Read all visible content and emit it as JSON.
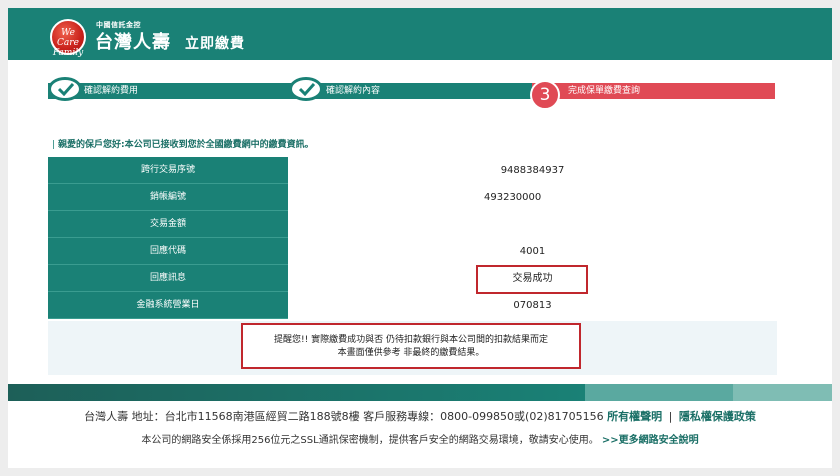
{
  "header": {
    "logo_text": "We Care Family",
    "brand_sub": "中國信託金控",
    "brand_name": "台灣人壽",
    "page_title": "立即繳費"
  },
  "steps": [
    {
      "label": "確認解約費用",
      "state": "done"
    },
    {
      "label": "確認解約內容",
      "state": "done"
    },
    {
      "number": "3",
      "label": "完成保單繳費查詢",
      "state": "current"
    }
  ],
  "notice": {
    "bar": "|",
    "text": "親愛的保戶您好:本公司已接收到您於全國繳費網中的繳費資訊。"
  },
  "table": {
    "rows": [
      {
        "label": "跨行交易序號",
        "value": "9488384937"
      },
      {
        "label": "銷帳編號",
        "value": "493230000"
      },
      {
        "label": "交易金額",
        "value": ""
      },
      {
        "label": "回應代碼",
        "value": "4001"
      },
      {
        "label": "回應訊息",
        "value": "交易成功"
      },
      {
        "label": "金融系統營業日",
        "value": "070813"
      }
    ]
  },
  "reminder": {
    "line1": "提醒您!! 實際繳費成功與否 仍待扣款銀行與本公司間的扣款結果而定",
    "line2": "本畫面僅供參考 非最終的繳費結果。"
  },
  "footer": {
    "address": "台灣人壽  地址：台北市11568南港區經貿二路188號8樓  客戶服務專線：0800-099850或(02)81705156",
    "copyright_link": "所有權聲明",
    "separator": "|",
    "privacy_link": "隱私權保護政策",
    "security_text": "本公司的網路安全係採用256位元之SSL通訊保密機制，提供客戶安全的網路交易環境，敬請安心使用。",
    "security_link": ">>更多網路安全說明"
  },
  "colors": {
    "brand_teal": "#1a8176",
    "step_red": "#e04a55",
    "highlight_red": "#c0272d"
  }
}
